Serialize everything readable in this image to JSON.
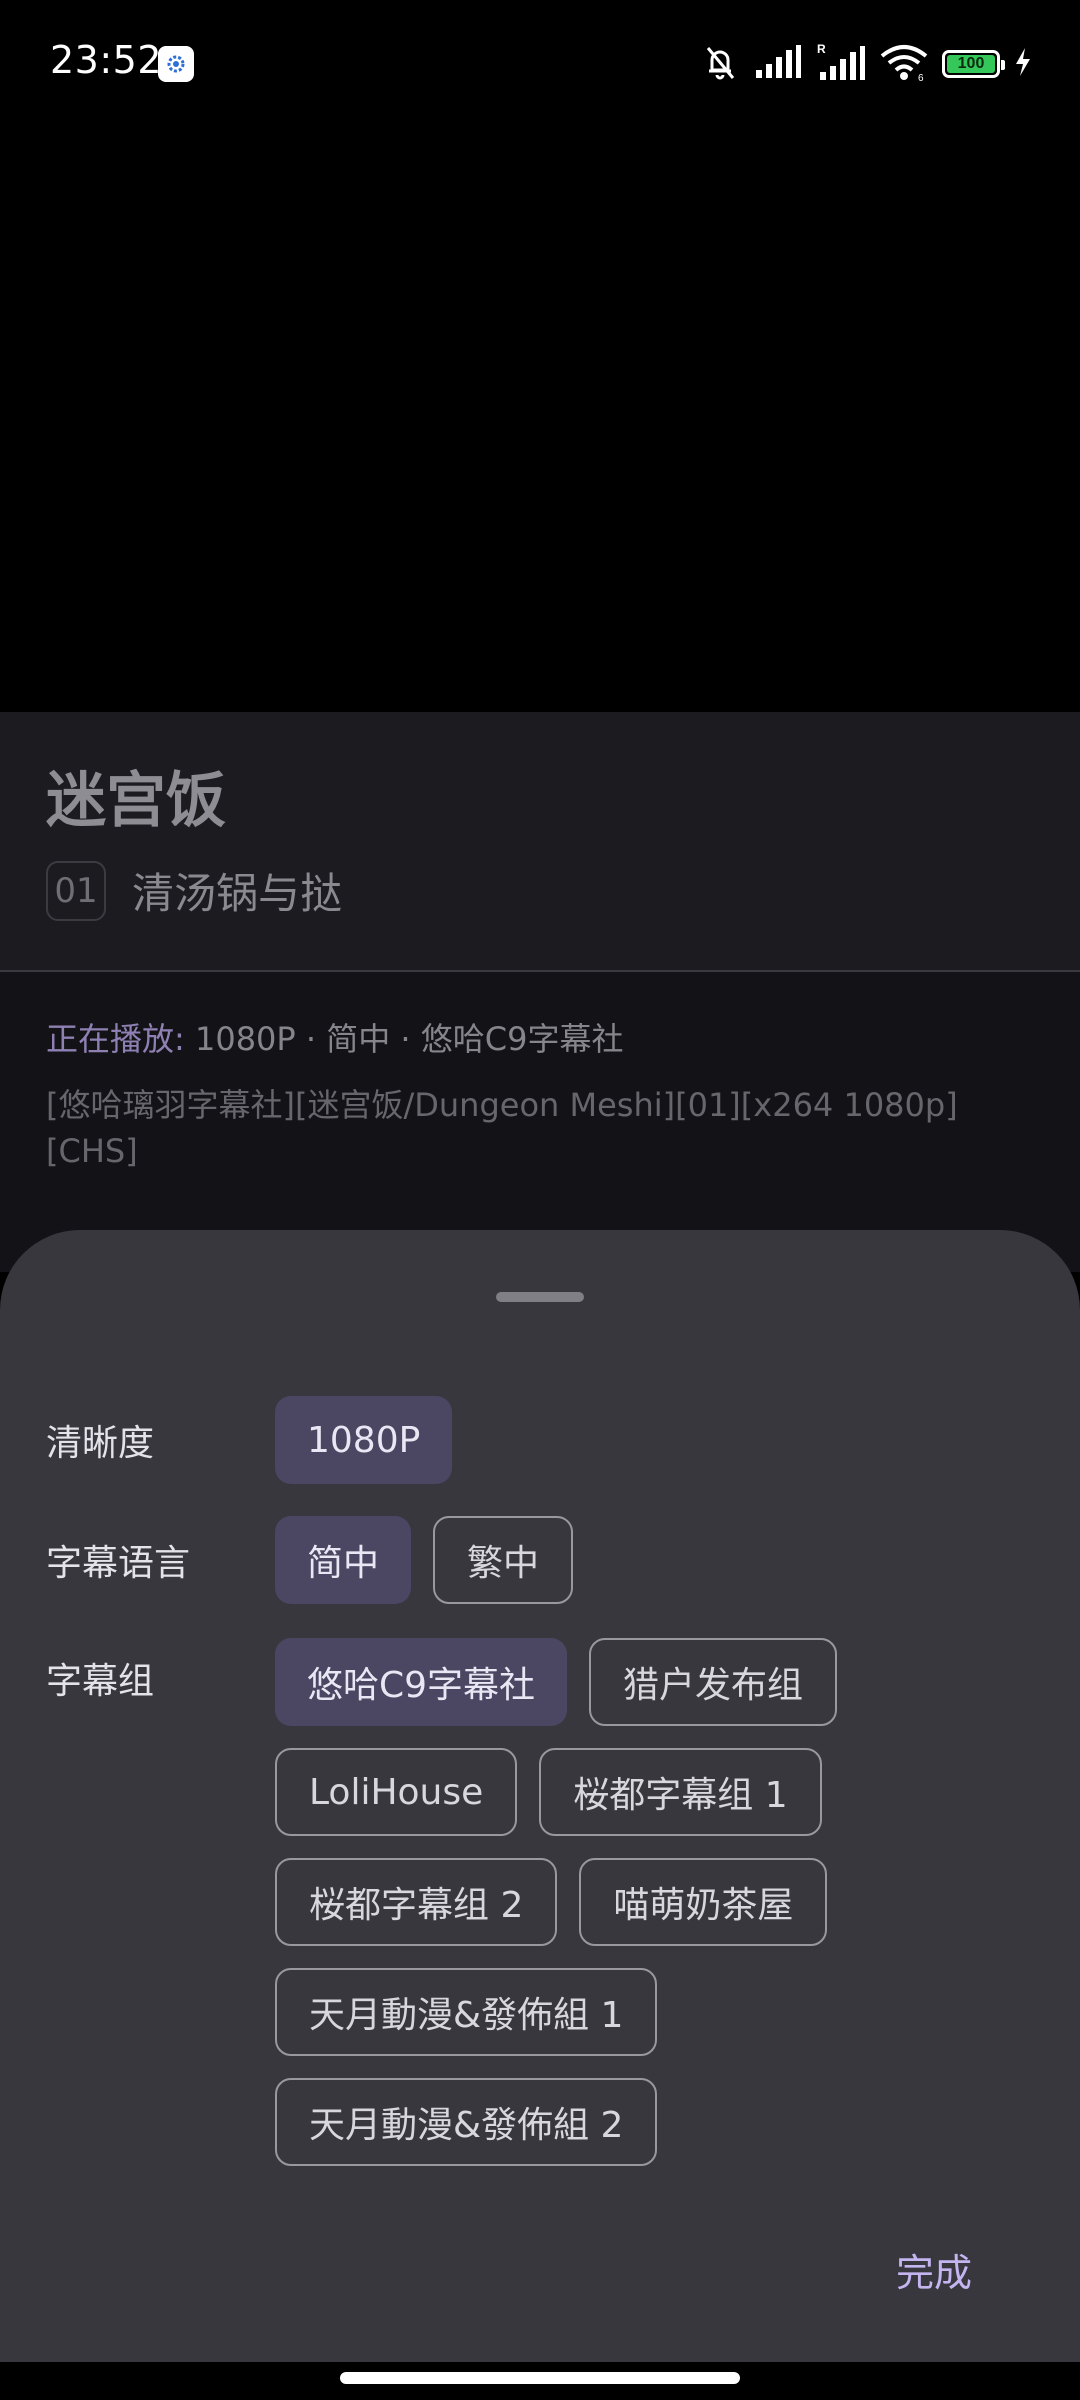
{
  "status_bar": {
    "time": "23:52",
    "battery_level": "100",
    "colors": {
      "battery_fill": "#35c759"
    },
    "icons": [
      "settings-app-icon",
      "silent-mode-icon",
      "signal-icon",
      "roaming-signal-icon",
      "wifi-icon",
      "battery-icon",
      "charging-icon"
    ]
  },
  "anime": {
    "title": "迷宫饭",
    "episode_number": "01",
    "episode_title": "清汤锅与挞"
  },
  "now_playing": {
    "label": "正在播放:",
    "summary": "1080P · 简中 · 悠哈C9字幕社",
    "file_name": "[悠哈璃羽字幕社][迷宫饭/Dungeon Meshi][01][x264 1080p][CHS]"
  },
  "sheet": {
    "resolution": {
      "label": "清晰度",
      "options": [
        {
          "label": "1080P",
          "selected": true
        }
      ]
    },
    "subtitle_language": {
      "label": "字幕语言",
      "options": [
        {
          "label": "简中",
          "selected": true
        },
        {
          "label": "繁中",
          "selected": false
        }
      ]
    },
    "subtitle_group": {
      "label": "字幕组",
      "options": [
        {
          "label": "悠哈C9字幕社",
          "selected": true
        },
        {
          "label": "猎户发布组",
          "selected": false
        },
        {
          "label": "LoliHouse",
          "selected": false
        },
        {
          "label": "桜都字幕组 1",
          "selected": false
        },
        {
          "label": "桜都字幕组 2",
          "selected": false
        },
        {
          "label": "喵萌奶茶屋",
          "selected": false
        },
        {
          "label": "天月動漫&發佈組 1",
          "selected": false
        },
        {
          "label": "天月動漫&發佈組 2",
          "selected": false
        }
      ]
    },
    "done_label": "完成",
    "colors": {
      "accent": "#c4b5f0",
      "selected_chip": "#4b4661",
      "sheet_bg": "#38373e"
    }
  }
}
